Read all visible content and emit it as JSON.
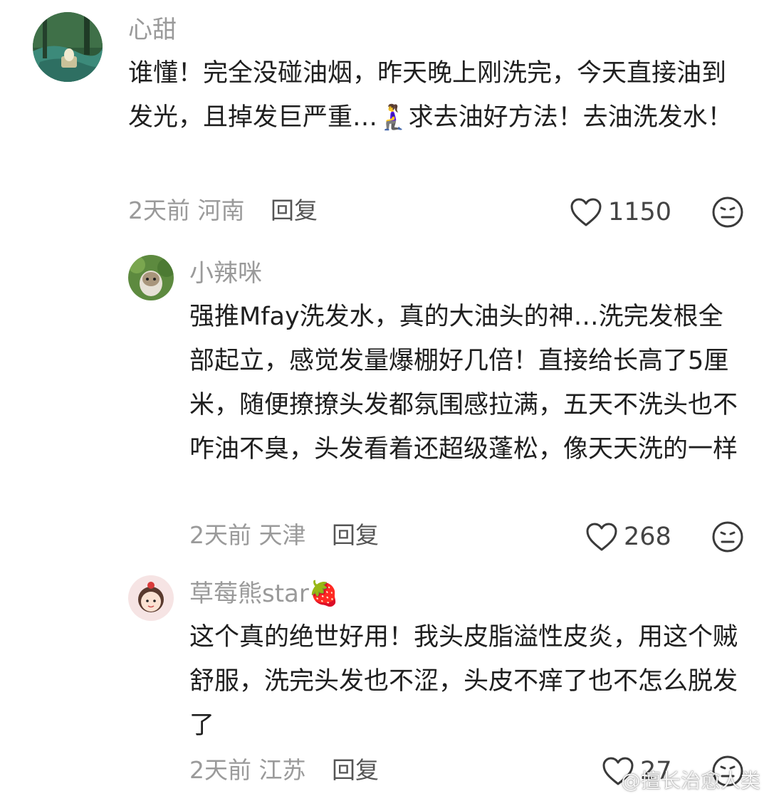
{
  "comments": [
    {
      "username": "心甜",
      "text": "谁懂！完全没碰油烟，昨天晚上刚洗完，今天直接油到发光，且掉发巨严重…🧎‍♀️求去油好方法！去油洗发水！",
      "time": "2天前",
      "location": "河南",
      "reply_label": "回复",
      "likes": "1150"
    },
    {
      "username": "小辣咪",
      "text": "强推Mfay洗发水，真的大油头的神…洗完发根全部起立，感觉发量爆棚好几倍！直接给长高了5厘米，随便撩撩头发都氛围感拉满，五天不洗头也不咋油不臭，头发看着还超级蓬松，像天天洗的一样",
      "time": "2天前",
      "location": "天津",
      "reply_label": "回复",
      "likes": "268"
    },
    {
      "username": "草莓熊star🍓",
      "text": "这个真的绝世好用！我头皮脂溢性皮炎，用这个贼舒服，洗完头发也不涩，头皮不痒了也不怎么脱发了",
      "time": "2天前",
      "location": "江苏",
      "reply_label": "回复",
      "likes": "27"
    }
  ],
  "watermark": "@擅长治愈人类",
  "icons": {
    "like": "heart-outline-icon",
    "dislike": "neutral-face-icon"
  },
  "colors": {
    "muted_text": "#9a9a9a",
    "body_text": "#1f1f1f"
  }
}
